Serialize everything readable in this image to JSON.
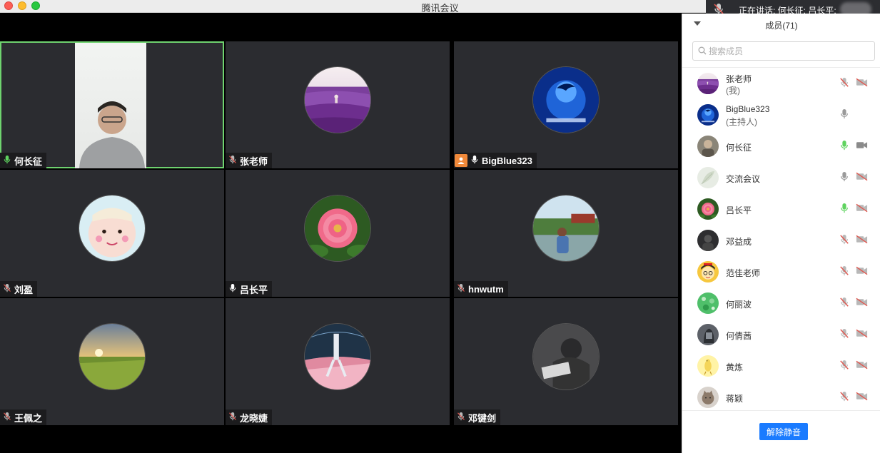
{
  "window": {
    "title": "腾讯会议"
  },
  "speaking": {
    "text": "正在讲话: 何长征; 吕长平;"
  },
  "tiles": [
    {
      "name": "何长征",
      "mic": "on",
      "active": true,
      "kind": "video"
    },
    {
      "name": "张老师",
      "mic": "muted",
      "kind": "avatar",
      "avatar": "lavender"
    },
    {
      "name": "BigBlue323",
      "mic": "on",
      "host_badge": true,
      "kind": "avatar",
      "avatar": "dolphin"
    },
    {
      "name": "刘盈",
      "mic": "muted",
      "kind": "avatar",
      "avatar": "baby"
    },
    {
      "name": "吕长平",
      "mic": "on",
      "kind": "avatar",
      "avatar": "peony"
    },
    {
      "name": "hnwutm",
      "mic": "muted",
      "kind": "avatar",
      "avatar": "park"
    },
    {
      "name": "王佩之",
      "mic": "muted",
      "kind": "avatar",
      "avatar": "field"
    },
    {
      "name": "龙晓婕",
      "mic": "muted",
      "kind": "avatar",
      "avatar": "skater"
    },
    {
      "name": "邓键剑",
      "mic": "muted",
      "kind": "avatar",
      "avatar": "reader"
    }
  ],
  "sidebar": {
    "title": "成员(71)",
    "search_placeholder": "搜索成员",
    "members": [
      {
        "name": "张老师",
        "role": "(我)",
        "mic": "muted",
        "cam": "off",
        "avatar": "lavender"
      },
      {
        "name": "BigBlue323",
        "role": "(主持人)",
        "mic": "idle",
        "cam": "none",
        "avatar": "dolphin"
      },
      {
        "name": "何长征",
        "role": "",
        "mic": "speaking",
        "cam": "on",
        "avatar": "person"
      },
      {
        "name": "交流会议",
        "role": "",
        "mic": "idle",
        "cam": "off",
        "avatar": "leaf"
      },
      {
        "name": "吕长平",
        "role": "",
        "mic": "speaking",
        "cam": "off",
        "avatar": "peony"
      },
      {
        "name": "邓益成",
        "role": "",
        "mic": "muted",
        "cam": "off",
        "avatar": "dark"
      },
      {
        "name": "范佳老师",
        "role": "",
        "mic": "muted",
        "cam": "off",
        "avatar": "cartoon"
      },
      {
        "name": "何丽波",
        "role": "",
        "mic": "muted",
        "cam": "off",
        "avatar": "green"
      },
      {
        "name": "何倩茜",
        "role": "",
        "mic": "muted",
        "cam": "off",
        "avatar": "gray"
      },
      {
        "name": "黄炼",
        "role": "",
        "mic": "muted",
        "cam": "off",
        "avatar": "yellow"
      },
      {
        "name": "蒋颖",
        "role": "",
        "mic": "muted",
        "cam": "off",
        "avatar": "cat"
      }
    ],
    "unmute_label": "解除静音"
  }
}
